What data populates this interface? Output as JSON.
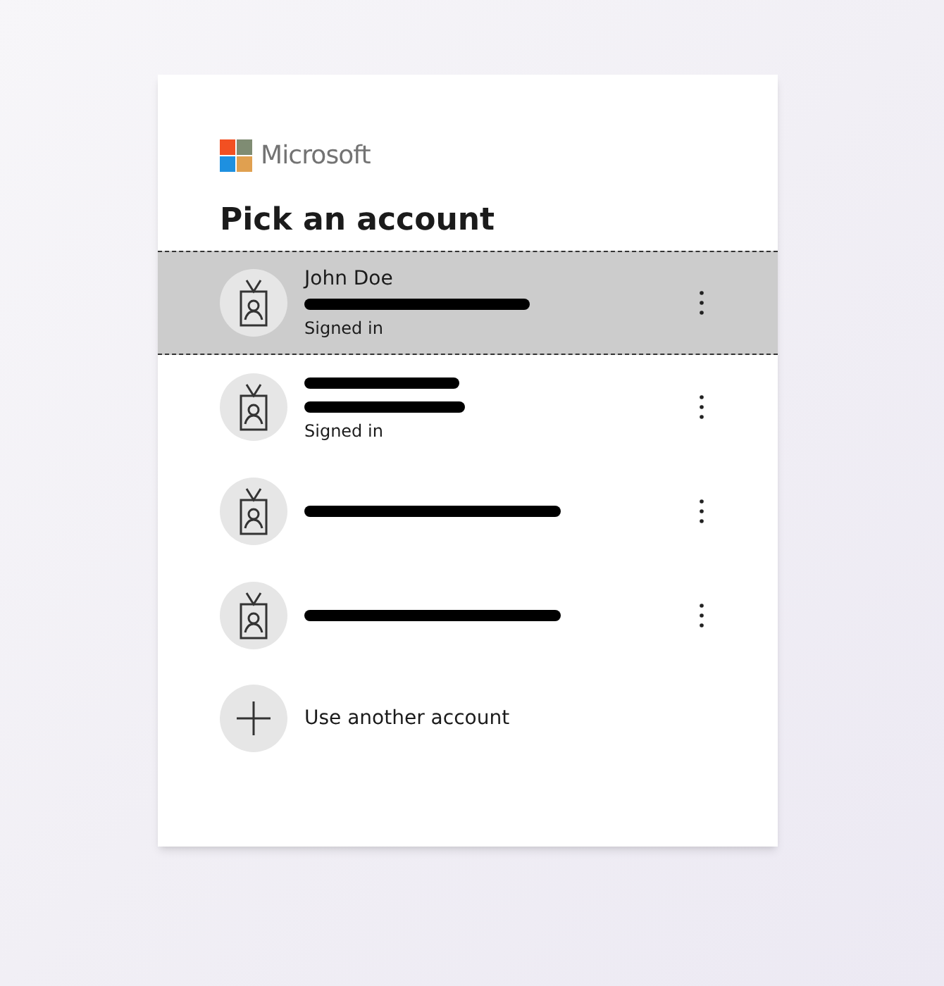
{
  "brand": {
    "name": "Microsoft"
  },
  "title": "Pick an account",
  "accounts": [
    {
      "selected": true,
      "lines": [
        {
          "kind": "name",
          "text": "John Doe"
        },
        {
          "kind": "redacted"
        },
        {
          "kind": "status",
          "text": "Signed in"
        }
      ]
    },
    {
      "selected": false,
      "lines": [
        {
          "kind": "redacted"
        },
        {
          "kind": "redacted"
        },
        {
          "kind": "status",
          "text": "Signed in"
        }
      ]
    },
    {
      "selected": false,
      "lines": [
        {
          "kind": "redacted"
        }
      ]
    },
    {
      "selected": false,
      "lines": [
        {
          "kind": "redacted"
        }
      ]
    }
  ],
  "add_account": {
    "label": "Use another account"
  }
}
